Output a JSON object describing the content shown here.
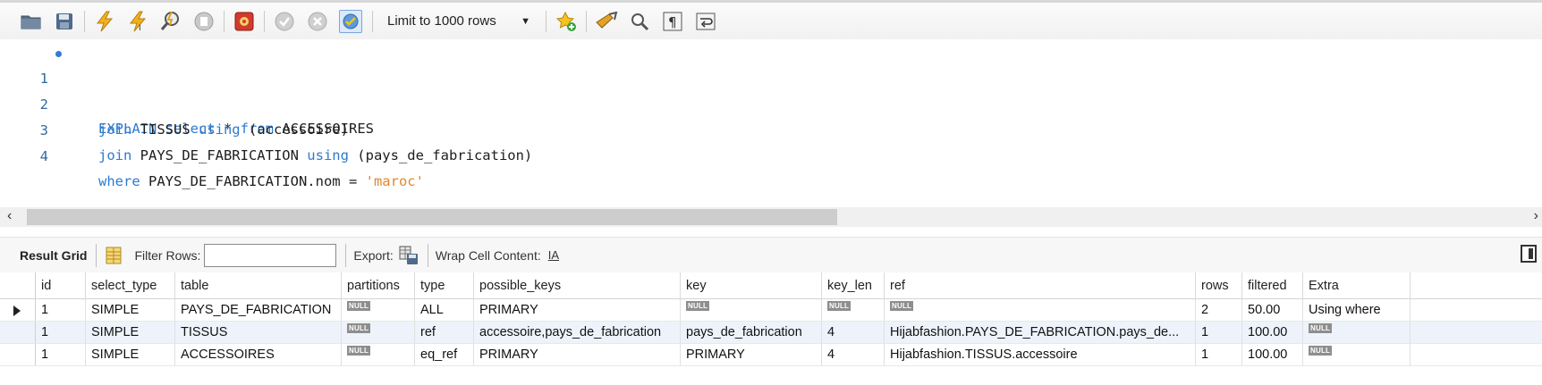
{
  "toolbar": {
    "icons": [
      "open-file-icon",
      "save-icon",
      "execute-icon",
      "execute-current-icon",
      "explain-icon",
      "stop-icon",
      "toggle-error-icon",
      "commit-icon",
      "rollback-icon",
      "autocommit-icon",
      "beautify-icon",
      "find-icon",
      "invisible-chars-icon",
      "wrap-icon"
    ],
    "limit_label": "Limit to 1000 rows"
  },
  "editor": {
    "lines": [
      {
        "number": "1",
        "tokens": [
          "EXPLAIN",
          " ",
          "select",
          " * ",
          "from",
          " ACCESSOIRES"
        ]
      },
      {
        "number": "2",
        "tokens": [
          "join",
          " TISSUS ",
          "using",
          " (accessoire)"
        ]
      },
      {
        "number": "3",
        "tokens": [
          "join",
          " PAYS_DE_FABRICATION ",
          "using",
          " (pays_de_fabrication)"
        ]
      },
      {
        "number": "4",
        "tokens": [
          "where",
          " PAYS_DE_FABRICATION.nom = ",
          "'maroc'"
        ]
      }
    ]
  },
  "result_toolbar": {
    "result_grid_label": "Result Grid",
    "filter_label": "Filter Rows:",
    "filter_value": "",
    "export_label": "Export:",
    "wrap_label": "Wrap Cell Content:",
    "wrap_icon_text": "IA"
  },
  "grid": {
    "columns": [
      "id",
      "select_type",
      "table",
      "partitions",
      "type",
      "possible_keys",
      "key",
      "key_len",
      "ref",
      "rows",
      "filtered",
      "Extra"
    ],
    "null_text": "NULL",
    "rows": [
      [
        "1",
        "SIMPLE",
        "PAYS_DE_FABRICATION",
        "NULL",
        "ALL",
        "PRIMARY",
        "NULL",
        "NULL",
        "NULL",
        "2",
        "50.00",
        "Using where"
      ],
      [
        "1",
        "SIMPLE",
        "TISSUS",
        "NULL",
        "ref",
        "accessoire,pays_de_fabrication",
        "pays_de_fabrication",
        "4",
        "Hijabfashion.PAYS_DE_FABRICATION.pays_de...",
        "1",
        "100.00",
        "NULL"
      ],
      [
        "1",
        "SIMPLE",
        "ACCESSOIRES",
        "NULL",
        "eq_ref",
        "PRIMARY",
        "PRIMARY",
        "4",
        "Hijabfashion.TISSUS.accessoire",
        "1",
        "100.00",
        "NULL"
      ]
    ]
  }
}
